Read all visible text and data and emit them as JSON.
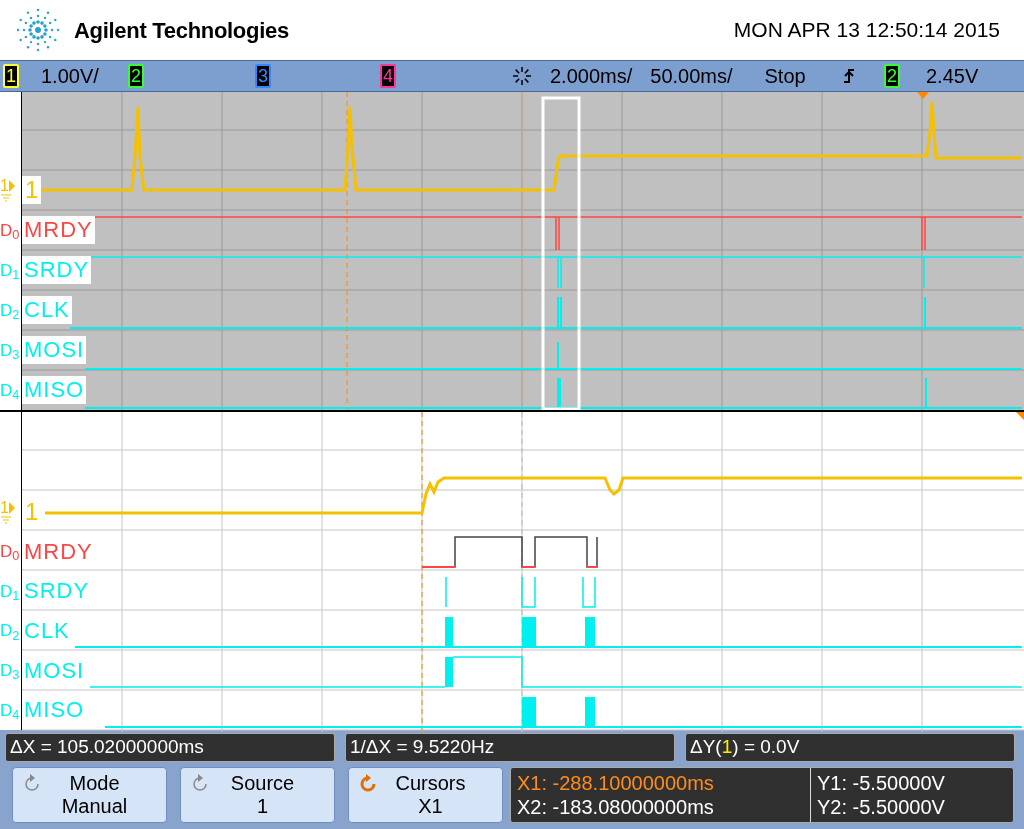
{
  "header": {
    "brand": "Agilent Technologies",
    "datetime": "MON APR 13 12:50:14 2015"
  },
  "channel_bar": {
    "channels": [
      {
        "label": "1",
        "scale": "1.00V/",
        "color": "#ffff33"
      },
      {
        "label": "2",
        "color": "#33ff33"
      },
      {
        "label": "3",
        "color": "#3388ff"
      },
      {
        "label": "4",
        "color": "#ff3399"
      }
    ],
    "time_scales": [
      "2.000ms/",
      "50.00ms/"
    ],
    "run_state": "Stop",
    "trigger": {
      "channel": "2",
      "color": "#33ff33",
      "level": "2.45V"
    }
  },
  "panes": [
    {
      "kind": "main",
      "analog": {
        "marker": "1",
        "label": "1"
      },
      "digital": [
        {
          "marker": "D$_{0}$",
          "name": "MRDY",
          "color": "#ff4444"
        },
        {
          "marker": "D$_{1}$",
          "name": "SRDY",
          "color": "#00f0f0"
        },
        {
          "marker": "D$_{2}$",
          "name": "CLK",
          "color": "#00f0f0"
        },
        {
          "marker": "D$_{3}$",
          "name": "MOSI",
          "color": "#00f0f0"
        },
        {
          "marker": "D$_{4}$",
          "name": "MISO",
          "color": "#00f0f0"
        }
      ]
    },
    {
      "kind": "zoom",
      "analog": {
        "marker": "1",
        "label": "1"
      },
      "digital": [
        {
          "marker": "D$_{0}$",
          "name": "MRDY",
          "color": "#ff4444"
        },
        {
          "marker": "D$_{1}$",
          "name": "SRDY",
          "color": "#00f0f0"
        },
        {
          "marker": "D$_{2}$",
          "name": "CLK",
          "color": "#00f0f0"
        },
        {
          "marker": "D$_{3}$",
          "name": "MOSI",
          "color": "#00f0f0"
        },
        {
          "marker": "D$_{4}$",
          "name": "MISO",
          "color": "#00f0f0"
        }
      ]
    }
  ],
  "measurements": {
    "delta_x": "ΔX = 105.02000000ms",
    "inverse_delta_x": "1/ΔX = 9.5220Hz",
    "delta_y": {
      "prefix": "ΔY(",
      "channel": "1",
      "suffix": ") = 0.0V"
    }
  },
  "softkeys": [
    {
      "title": "Mode",
      "value": "Manual",
      "selected": false
    },
    {
      "title": "Source",
      "value": "1",
      "selected": false
    },
    {
      "title": "Cursors",
      "value": "X1",
      "selected": true
    }
  ],
  "cursor_readout": {
    "x": [
      {
        "text": "X1: -288.10000000ms",
        "selected": true
      },
      {
        "text": "X2: -183.08000000ms",
        "selected": false
      }
    ],
    "y": [
      "Y1: -5.50000V",
      "Y2: -5.50000V"
    ]
  }
}
